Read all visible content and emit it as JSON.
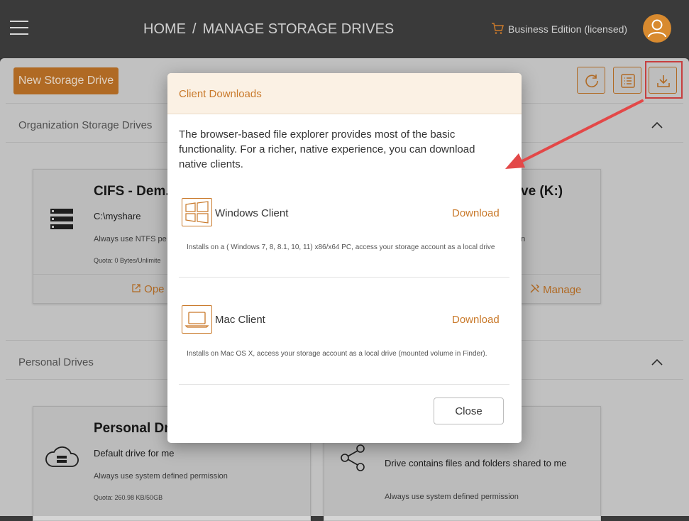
{
  "header": {
    "breadcrumb": [
      "HOME",
      "MANAGE STORAGE DRIVES"
    ],
    "breadcrumb_sep": "/",
    "edition": "Business Edition (licensed)"
  },
  "toolbar": {
    "new_drive_label": "New Storage Drive"
  },
  "sections": {
    "org_title": "Organization Storage Drives",
    "personal_title": "Personal Drives"
  },
  "org_cards": [
    {
      "title": "CIFS - Dem.",
      "path": "C:\\myshare",
      "permission": "Always use NTFS pe",
      "quota": "Quota: 0 Bytes/Unlimite",
      "action": "Ope"
    },
    {
      "title": "ve  (K:)",
      "permission": "on",
      "action": "Manage"
    }
  ],
  "personal_cards": [
    {
      "title": "Personal Dr",
      "desc": "Default drive for me",
      "permission": "Always use system defined permission",
      "quota": "Quota: 260.98 KB/50GB"
    },
    {
      "desc": "Drive contains files and folders shared to me",
      "permission": "Always use system defined permission"
    }
  ],
  "modal": {
    "title": "Client Downloads",
    "description": "The browser-based file explorer provides most of the basic functionality. For a richer, native experience, you can download native clients.",
    "clients": [
      {
        "name": "Windows Client",
        "download_label": "Download",
        "note": "Installs on a ( Windows 7, 8, 8.1, 10, 11) x86/x64 PC, access your storage account as a local drive",
        "icon": "windows-icon"
      },
      {
        "name": "Mac Client",
        "download_label": "Download",
        "note": "Installs on Mac OS X, access your storage account as a local drive (mounted volume in Finder).",
        "icon": "laptop-icon"
      }
    ],
    "close_label": "Close"
  },
  "colors": {
    "accent": "#c9792a",
    "highlight": "#e34848"
  }
}
